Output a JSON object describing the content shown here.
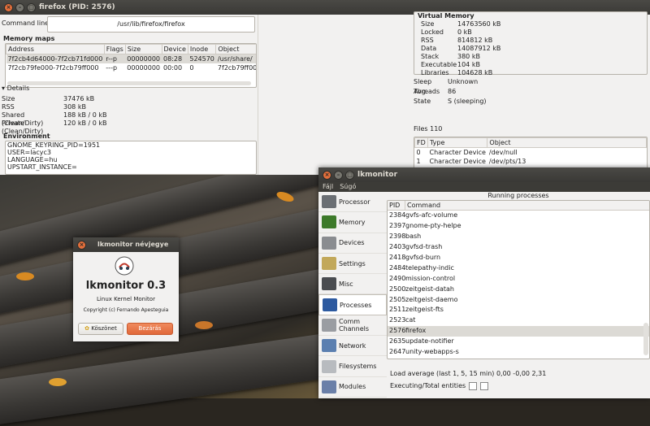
{
  "firefox_window": {
    "title": "firefox (PID: 2576)",
    "command_line_label": "Command line",
    "command_line_value": "/usr/lib/firefox/firefox",
    "memory_maps_label": "Memory maps",
    "maps_columns": [
      "Address",
      "Flags",
      "Size",
      "Device",
      "Inode",
      "Object"
    ],
    "maps_rows": [
      [
        "7f2cb4d64000-7f2cb71fd000",
        "r--p",
        "00000000",
        "08:28",
        "524570",
        "/usr/share/"
      ],
      [
        "7f2cb79fe000-7f2cb79ff000",
        "---p",
        "00000000",
        "00:00",
        "0",
        "7f2cb79ff00"
      ]
    ],
    "details_label": "Details",
    "details": [
      {
        "k": "Size",
        "v": "37476 kB"
      },
      {
        "k": "RSS",
        "v": "308 kB"
      },
      {
        "k": "Shared (Clean/Dirty)",
        "v": "188 kB / 0 kB"
      },
      {
        "k": "Private (Clean/Dirty)",
        "v": "120 kB / 0 kB"
      }
    ],
    "environment_label": "Environment",
    "environment": [
      "GNOME_KEYRING_PID=1951",
      "USER=lacyc3",
      "LANGUAGE=hu",
      "UPSTART_INSTANCE="
    ],
    "virtual_memory_label": "Virtual Memory",
    "vm": [
      {
        "k": "Size",
        "v": "14763560 kB"
      },
      {
        "k": "Locked",
        "v": "0 kB"
      },
      {
        "k": "RSS",
        "v": "814812 kB"
      },
      {
        "k": "Data",
        "v": "14087912 kB"
      },
      {
        "k": "Stack",
        "v": "380 kB"
      },
      {
        "k": "Executable",
        "v": "104 kB"
      },
      {
        "k": "Libraries",
        "v": "104628 kB"
      }
    ],
    "stats": [
      {
        "k": "Sleep Avg.",
        "v": "Unknown"
      },
      {
        "k": "Threads",
        "v": "86"
      },
      {
        "k": "State",
        "v": "S (sleeping)"
      }
    ],
    "files_label": "Files",
    "files_count": "110",
    "files_columns": [
      "FD",
      "Type",
      "Object"
    ],
    "files_rows": [
      [
        "0",
        "Character Device",
        "/dev/null"
      ],
      [
        "1",
        "Character Device",
        "/dev/pts/13"
      ]
    ]
  },
  "about": {
    "title": "lkmonitor névjegye",
    "app_name": "lkmonitor 0.3",
    "subtitle": "Linux Kernel Monitor",
    "copyright": "Copyright (c) Fernando Apesteguia",
    "thanks_button": "Köszönet",
    "close_button": "Bezárás"
  },
  "lkmonitor": {
    "title": "lkmonitor",
    "menu": [
      "Fájl",
      "Súgó"
    ],
    "panel_title": "Running processes",
    "sidebar": [
      {
        "label": "Processor",
        "icon": "processor-icon",
        "color": "#6b6f74"
      },
      {
        "label": "Memory",
        "icon": "memory-icon",
        "color": "#3d7a2a"
      },
      {
        "label": "Devices",
        "icon": "devices-icon",
        "color": "#8a8c90"
      },
      {
        "label": "Settings",
        "icon": "settings-icon",
        "color": "#c2a85a"
      },
      {
        "label": "Misc",
        "icon": "misc-icon",
        "color": "#4a4c50"
      },
      {
        "label": "Processes",
        "icon": "processes-icon",
        "color": "#2d5aa0"
      },
      {
        "label": "Comm Channels",
        "icon": "comm-channels-icon",
        "color": "#9a9da2"
      },
      {
        "label": "Network",
        "icon": "network-icon",
        "color": "#5b7fb0"
      },
      {
        "label": "Filesystems",
        "icon": "filesystems-icon",
        "color": "#b8bbbf"
      },
      {
        "label": "Modules",
        "icon": "modules-icon",
        "color": "#6a7fa8"
      }
    ],
    "columns": [
      "PID",
      "Command"
    ],
    "processes": [
      [
        "2384",
        "gvfs-afc-volume"
      ],
      [
        "2397",
        "gnome-pty-helpe"
      ],
      [
        "2398",
        "bash"
      ],
      [
        "2403",
        "gvfsd-trash"
      ],
      [
        "2418",
        "gvfsd-burn"
      ],
      [
        "2484",
        "telepathy-indic"
      ],
      [
        "2490",
        "mission-control"
      ],
      [
        "2500",
        "zeitgeist-datah"
      ],
      [
        "2505",
        "zeitgeist-daemo"
      ],
      [
        "2511",
        "zeitgeist-fts"
      ],
      [
        "2523",
        "cat"
      ],
      [
        "2576",
        "firefox"
      ],
      [
        "2635",
        "update-notifier"
      ],
      [
        "2647",
        "unity-webapps-s"
      ]
    ],
    "selected_pid": "2576",
    "load_label": "Load average (last 1, 5, 15 min)",
    "load_value": "0,00 -0,00 2,31",
    "exec_label": "Executing/Total entities"
  }
}
